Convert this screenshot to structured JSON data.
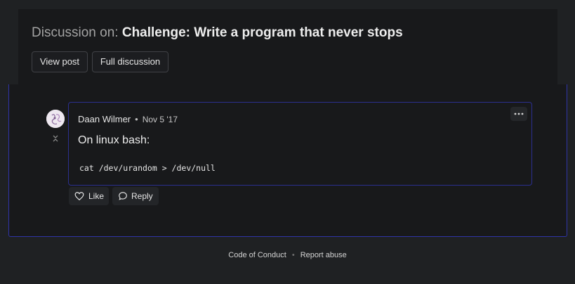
{
  "header": {
    "title_prefix": "Discussion on:",
    "title": "Challenge: Write a program that never stops",
    "buttons": {
      "view_post": "View post",
      "full_discussion": "Full discussion"
    }
  },
  "comment": {
    "author": "Daan Wilmer",
    "separator": "•",
    "date": "Nov 5 '17",
    "more_label": "···",
    "text": "On linux bash:",
    "code": "cat /dev/urandom > /dev/null",
    "actions": {
      "like": "Like",
      "reply": "Reply"
    }
  },
  "footer": {
    "code_of_conduct": "Code of Conduct",
    "separator": "•",
    "report_abuse": "Report abuse"
  },
  "icons": {
    "avatar": "avatar-image",
    "collapse": "collapse-icon",
    "like": "heart-icon",
    "reply": "speech-bubble-icon",
    "more": "more-horizontal-icon"
  },
  "colors": {
    "background": "#1f2123",
    "card": "#18191b",
    "accent_border": "#2f34a8"
  }
}
